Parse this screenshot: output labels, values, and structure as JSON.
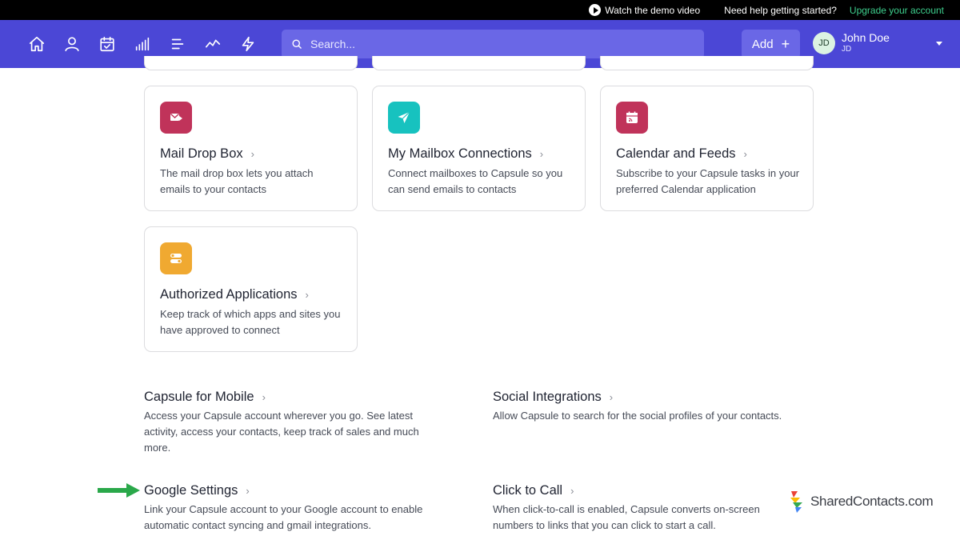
{
  "topbar": {
    "demo_label": "Watch the demo video",
    "help_label": "Need help getting started?",
    "upgrade_label": "Upgrade your account"
  },
  "nav": {
    "icons": [
      "home-icon",
      "person-icon",
      "calendar-check-icon",
      "bar-chart-icon",
      "list-icon",
      "trend-line-icon",
      "lightning-icon"
    ],
    "search_placeholder": "Search...",
    "add_label": "Add",
    "add_icon": "plus-icon",
    "user_initials": "JD",
    "user_name": "John Doe",
    "user_sub": "JD"
  },
  "cards": [
    {
      "title": "Mail Drop Box",
      "desc": "The mail drop box lets you attach emails to your contacts",
      "icon": "mail-drop-icon",
      "color": "#c0335a"
    },
    {
      "title": "My Mailbox Connections",
      "desc": "Connect mailboxes to Capsule so you can send emails to contacts",
      "icon": "paper-plane-icon",
      "color": "#17c2bf"
    },
    {
      "title": "Calendar and Feeds",
      "desc": "Subscribe to your Capsule tasks in your preferred Calendar application",
      "icon": "calendar-feed-icon",
      "color": "#c0335a"
    },
    {
      "title": "Authorized Applications",
      "desc": "Keep track of which apps and sites you have approved to connect",
      "icon": "toggles-icon",
      "color": "#f0a931"
    }
  ],
  "sections": [
    {
      "title": "Capsule for Mobile",
      "desc": "Access your Capsule account wherever you go. See latest activity, access your contacts, keep track of sales and much more."
    },
    {
      "title": "Social Integrations",
      "desc": "Allow Capsule to search for the social profiles of your contacts."
    },
    {
      "title": "Google Settings",
      "desc": "Link your Capsule account to your Google account to enable automatic contact syncing and gmail integrations."
    },
    {
      "title": "Click to Call",
      "desc": "When click-to-call is enabled, Capsule converts on-screen numbers to links that you can click to start a call."
    }
  ],
  "chevron": "›",
  "annotation": {
    "arrow_color": "#2aa84a"
  },
  "watermark": {
    "text": "SharedContacts.com"
  },
  "colors": {
    "nav_bg": "#4b47d6",
    "upgrade": "#3ecf8e"
  }
}
